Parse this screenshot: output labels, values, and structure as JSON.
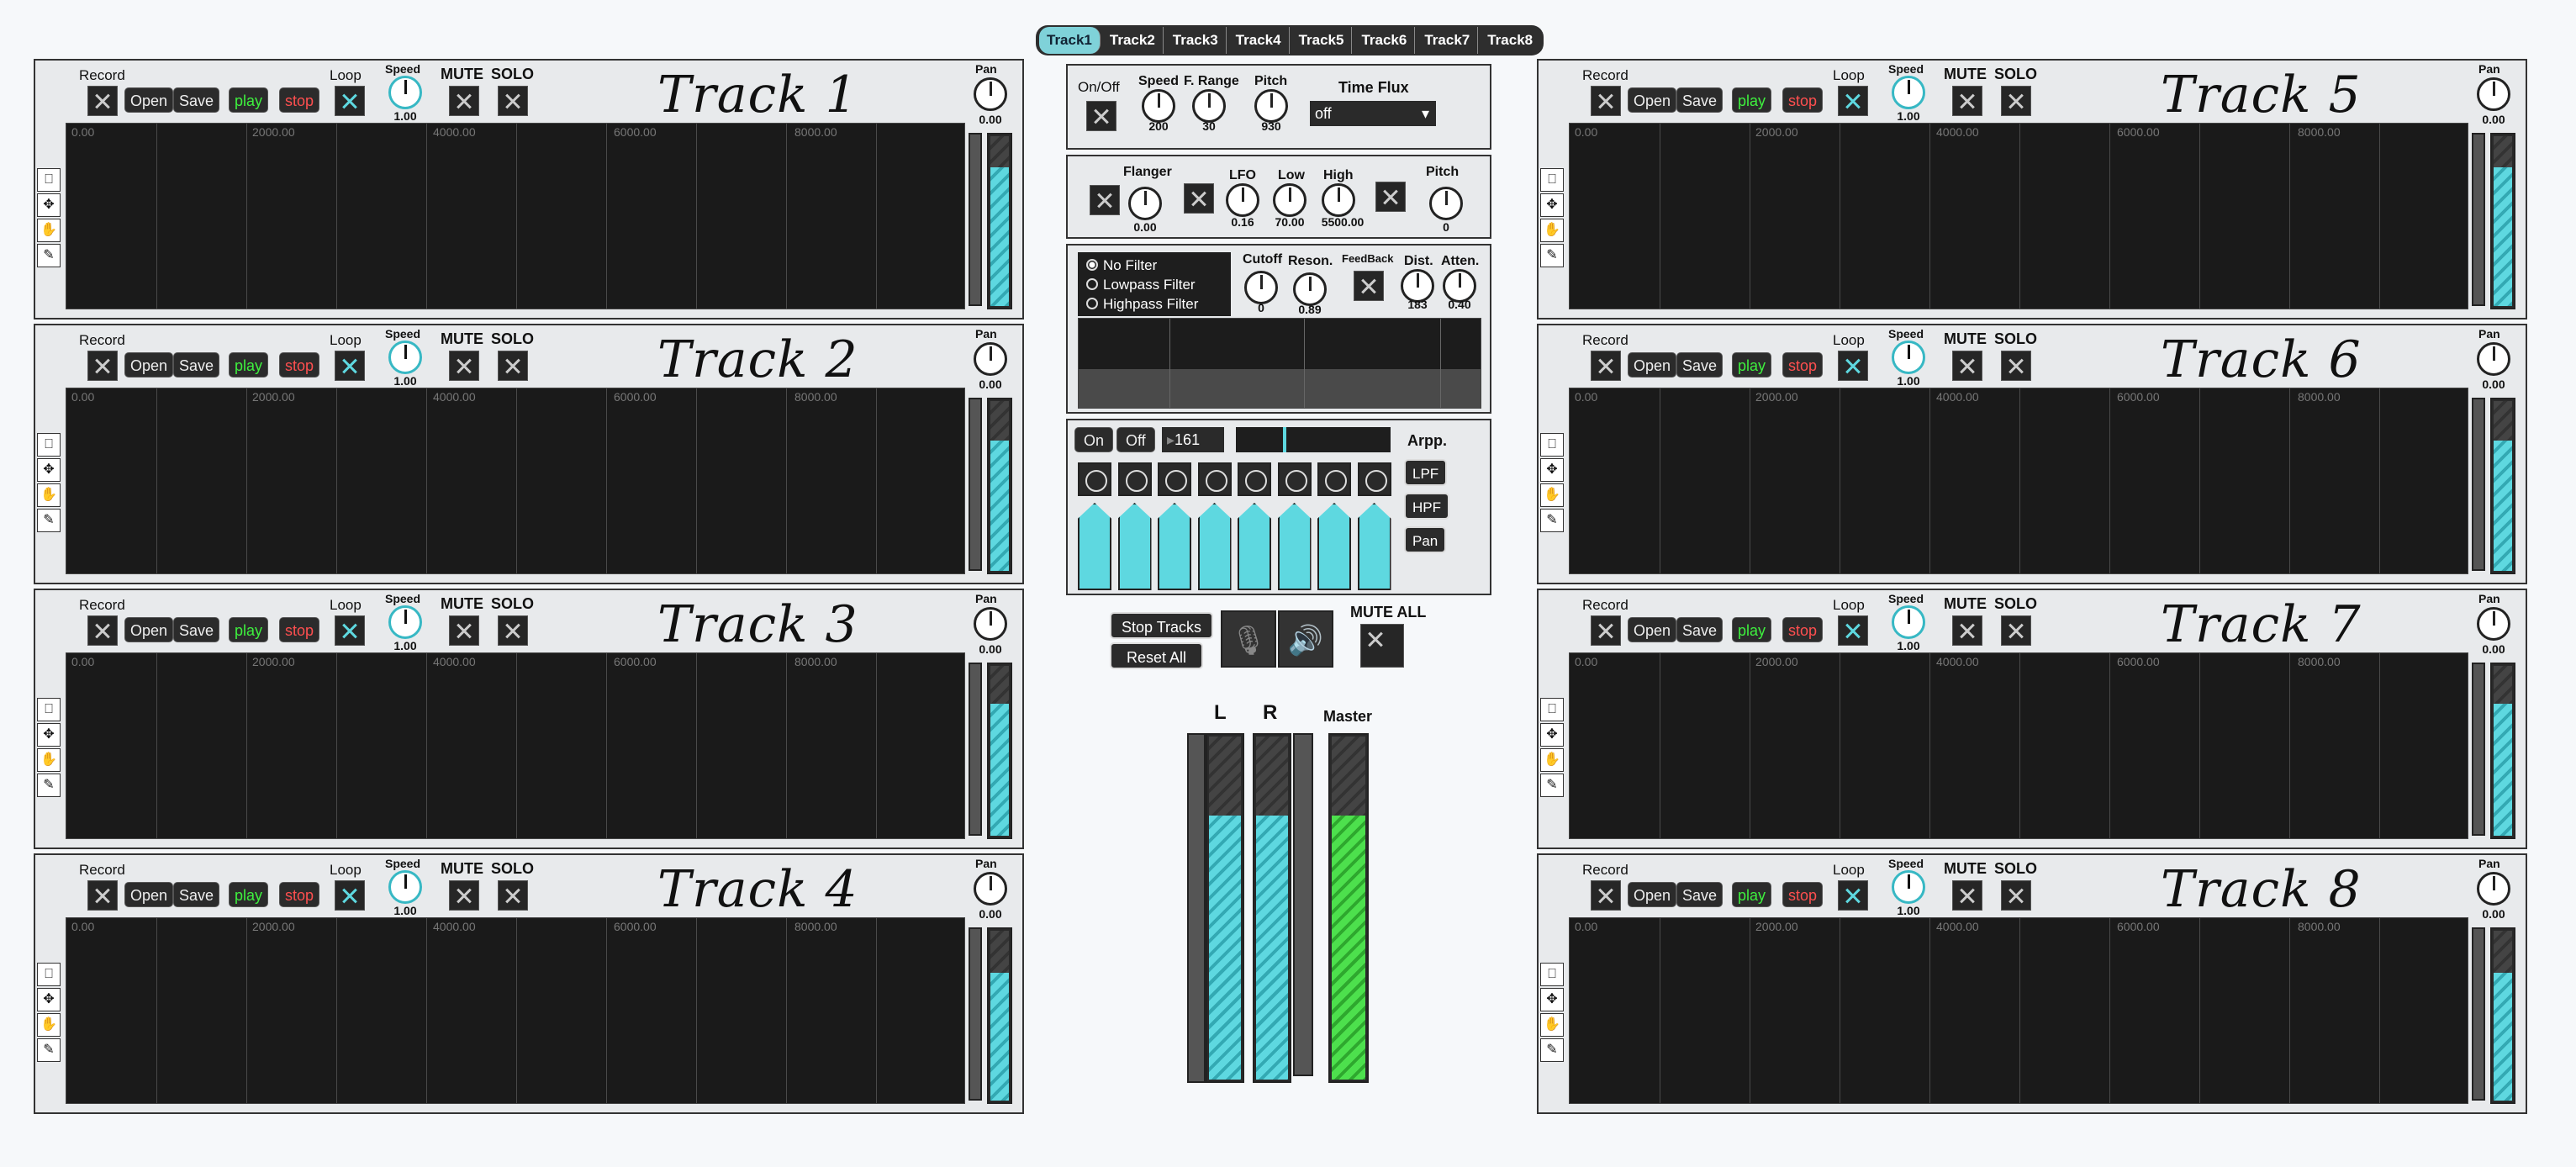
{
  "tabs": [
    "Track1",
    "Track2",
    "Track3",
    "Track4",
    "Track5",
    "Track6",
    "Track7",
    "Track8"
  ],
  "track_labels": {
    "record": "Record",
    "open": "Open",
    "save": "Save",
    "play": "play",
    "stop": "stop",
    "loop": "Loop",
    "speed": "Speed",
    "mute": "MUTE",
    "solo": "SOLO",
    "pan": "Pan",
    "speed_value": "1.00",
    "pan_value": "0.00"
  },
  "waveform_ticks": [
    "0.00",
    "2000.00",
    "4000.00",
    "6000.00",
    "8000.00"
  ],
  "tracks": [
    {
      "title": "Track 1",
      "level": 0.8
    },
    {
      "title": "Track 2",
      "level": 0.75
    },
    {
      "title": "Track 3",
      "level": 0.76
    },
    {
      "title": "Track 4",
      "level": 0.74
    },
    {
      "title": "Track 5",
      "level": 0.8
    },
    {
      "title": "Track 6",
      "level": 0.75
    },
    {
      "title": "Track 7",
      "level": 0.76
    },
    {
      "title": "Track 8",
      "level": 0.74
    }
  ],
  "timeflux": {
    "onoff": "On/Off",
    "speed": "Speed",
    "speed_value": "200",
    "frange": "F. Range",
    "frange_value": "30",
    "pitch": "Pitch",
    "pitch_value": "930",
    "title": "Time Flux",
    "mode": "off"
  },
  "flanger": {
    "flanger": "Flanger",
    "flanger_value": "0.00",
    "lfo": "LFO",
    "lfo_value": "0.16",
    "low": "Low",
    "low_value": "70.00",
    "high": "High",
    "high_value": "5500.00",
    "pitch": "Pitch",
    "pitch_value": "0"
  },
  "filter": {
    "options": [
      "No Filter",
      "Lowpass Filter",
      "Highpass Filter"
    ],
    "selected": 0,
    "cutoff": "Cutoff",
    "cutoff_value": "0",
    "reson": "Reson.",
    "reson_value": "0.89",
    "feedback": "FeedBack",
    "dist": "Dist.",
    "dist_value": "183",
    "atten": "Atten.",
    "atten_value": "0.40"
  },
  "arp": {
    "on": "On",
    "off": "Off",
    "bpm": "161",
    "title": "Arpp.",
    "lpf": "LPF",
    "hpf": "HPF",
    "pan": "Pan",
    "steps": 8
  },
  "transport": {
    "stop_tracks": "Stop Tracks",
    "reset_all": "Reset All",
    "mute_all": "MUTE ALL"
  },
  "master": {
    "l": "L",
    "r": "R",
    "master": "Master",
    "l_level": 0.77,
    "r_level": 0.77,
    "master_level": 0.77
  },
  "colors": {
    "accent": "#5ed8e0",
    "play": "#3ef03e",
    "stop": "#ff4f4f",
    "master": "#4de04d"
  }
}
